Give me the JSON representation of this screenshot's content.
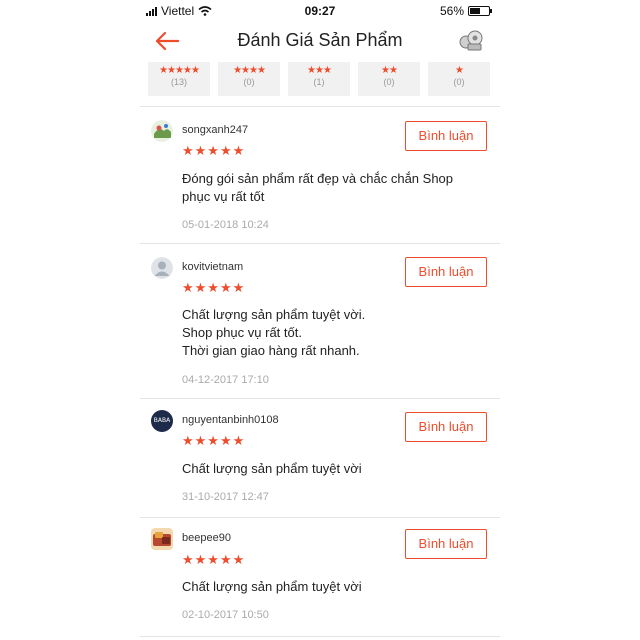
{
  "status": {
    "carrier": "Viettel",
    "time": "09:27",
    "battery": "56%",
    "battery_level": 0.56
  },
  "nav": {
    "title": "Đánh Giá Sản Phẩm"
  },
  "colors": {
    "accent": "#ee4d2d"
  },
  "filters": [
    {
      "stars": "★★★★★",
      "count": "(13)"
    },
    {
      "stars": "★★★★",
      "count": "(0)"
    },
    {
      "stars": "★★★",
      "count": "(1)"
    },
    {
      "stars": "★★",
      "count": "(0)"
    },
    {
      "stars": "★",
      "count": "(0)"
    }
  ],
  "reviews": [
    {
      "user": "songxanh247",
      "rating": 5,
      "stars": "★★★★★",
      "lines": [
        "Đóng gói sản phẩm rất đẹp và chắc chắn Shop",
        "phục vụ rất tốt"
      ],
      "date": "05-01-2018 10:24",
      "button": "Bình luận"
    },
    {
      "user": "kovitvietnam",
      "rating": 5,
      "stars": "★★★★★",
      "lines": [
        "Chất lượng sản phẩm tuyệt vời.",
        "Shop phục vụ rất tốt.",
        "Thời gian giao hàng rất nhanh."
      ],
      "date": "04-12-2017 17:10",
      "button": "Bình luận"
    },
    {
      "user": "nguyentanbinh0108",
      "avatar_text": "BABA",
      "rating": 5,
      "stars": "★★★★★",
      "lines": [
        "Chất lượng sản phẩm tuyệt vời"
      ],
      "date": "31-10-2017 12:47",
      "button": "Bình luận"
    },
    {
      "user": "beepee90",
      "rating": 5,
      "stars": "★★★★★",
      "lines": [
        "Chất lượng sản phẩm tuyệt vời"
      ],
      "date": "02-10-2017 10:50",
      "button": "Bình luận"
    }
  ]
}
